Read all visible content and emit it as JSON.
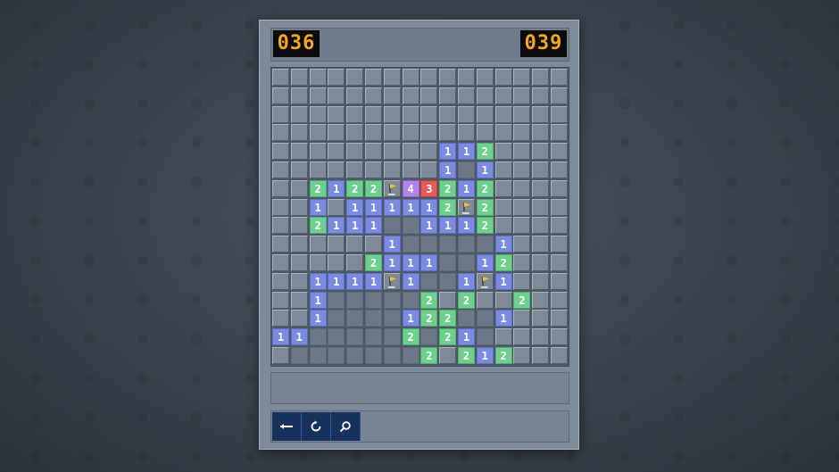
{
  "hud": {
    "mines_remaining": "036",
    "timer": "039"
  },
  "board": {
    "cols": 16,
    "rows": 16,
    "legend": "C = covered, . = revealed empty, F = flag, digits = adjacent mine count",
    "grid": [
      "CCCCCCCCCCCCCCCC",
      "CCCCCCCCCCCCCCCC",
      "CCCCCCCCCCCCCCCC",
      "CCCCCCCCCCCCCCCC",
      "CCCCCCCCC112CCCC",
      "CCCCCCCCC1.1CCCC",
      "CC2122F43212CCCC",
      "CC1C111112F2CCCC",
      "CC2111..1112CCCC",
      "CCCCCC1.....1CCC",
      "CCCCC2111..12CCC",
      "CC1111F1..1F1CCC",
      "CC1.....2C2CC2CC",
      "CC1....122..1CCC",
      "11.....2.21.CCCC",
      "C.......2C212CCC"
    ]
  },
  "toolbar": {
    "back_icon": "arrow-left-icon",
    "restart_icon": "restart-icon",
    "hint_icon": "magnifier-icon"
  },
  "colors": {
    "one": "#7b8be0",
    "two": "#6fcf8e",
    "three": "#e85a5a",
    "four": "#b283e8",
    "counter_text": "#f5a623"
  }
}
